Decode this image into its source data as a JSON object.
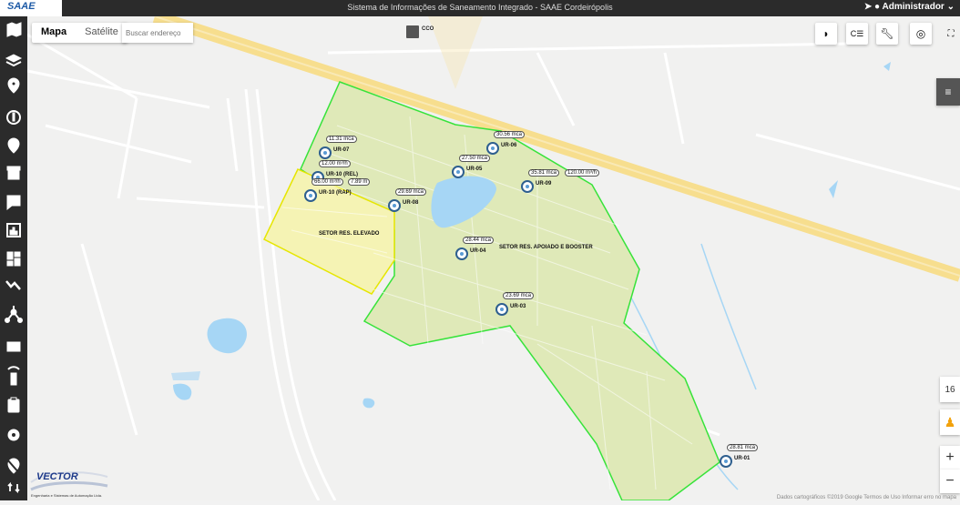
{
  "app": {
    "logo_text": "SAAE",
    "title": "Sistema de Informações de Saneamento Integrado - SAAE Cordeirópolis",
    "user": "Administrador"
  },
  "sidebar": {
    "items": [
      {
        "icon": "map-icon"
      },
      {
        "icon": "layers-icon"
      },
      {
        "icon": "location-pin-icon"
      },
      {
        "icon": "info-icon"
      },
      {
        "icon": "pin-edit-icon"
      },
      {
        "icon": "archive-icon"
      },
      {
        "icon": "alert-message-icon"
      },
      {
        "icon": "bar-chart-icon"
      },
      {
        "icon": "dashboard-icon"
      },
      {
        "icon": "trending-down-icon"
      },
      {
        "icon": "network-icon"
      },
      {
        "icon": "grid-icon"
      },
      {
        "icon": "remote-signal-icon"
      },
      {
        "icon": "clipboard-icon"
      },
      {
        "icon": "settings-icon"
      },
      {
        "icon": "location-off-icon"
      },
      {
        "icon": "swap-icon"
      }
    ]
  },
  "map": {
    "maptype": {
      "map_label": "Mapa",
      "satellite_label": "Satélite"
    },
    "search_placeholder": "Buscar endereço",
    "zoom_level": "16",
    "attribution": "Dados cartográficos ©2019 Google   Termos de Uso   Informar erro no mapa",
    "cco_label": "CCO",
    "sectors": [
      {
        "name": "SETOR RES. ELEVADO"
      },
      {
        "name": "SETOR RES. APOIADO E BOOSTER"
      }
    ],
    "stations": [
      {
        "id": "UR-07",
        "readings": [
          "11.31 mca"
        ]
      },
      {
        "id": "UR-10 (REL)",
        "readings": [
          "12.00 m³/h"
        ]
      },
      {
        "id": "UR-10 (RAP)",
        "readings": [
          "66.00 m³/h",
          "7.89 m"
        ]
      },
      {
        "id": "UR-06",
        "readings": [
          "30.56 mca"
        ]
      },
      {
        "id": "UR-05",
        "readings": [
          "27.50 mca"
        ]
      },
      {
        "id": "UR-08",
        "readings": [
          "29.69 mca"
        ]
      },
      {
        "id": "UR-09",
        "readings": [
          "35.81 mca",
          "120.00 m³/h"
        ]
      },
      {
        "id": "UR-04",
        "readings": [
          "28.44 mca"
        ]
      },
      {
        "id": "UR-03",
        "readings": [
          "23.69 mca"
        ]
      },
      {
        "id": "UR-01",
        "readings": [
          "28.81 mca"
        ]
      }
    ]
  },
  "brand": {
    "name": "VECTOR",
    "tagline": "Engenharia e Sistemas de Automação Ltda."
  },
  "colors": {
    "sector_apoiado": "#dfe9b8",
    "sector_apoiado_border": "#37e33a",
    "sector_elevado": "#f5f3b4",
    "sector_elevado_border": "#e6e600",
    "highway": "#f7de8e",
    "water": "#a6d6f5",
    "sidebar_bg": "#2b2b2b"
  }
}
